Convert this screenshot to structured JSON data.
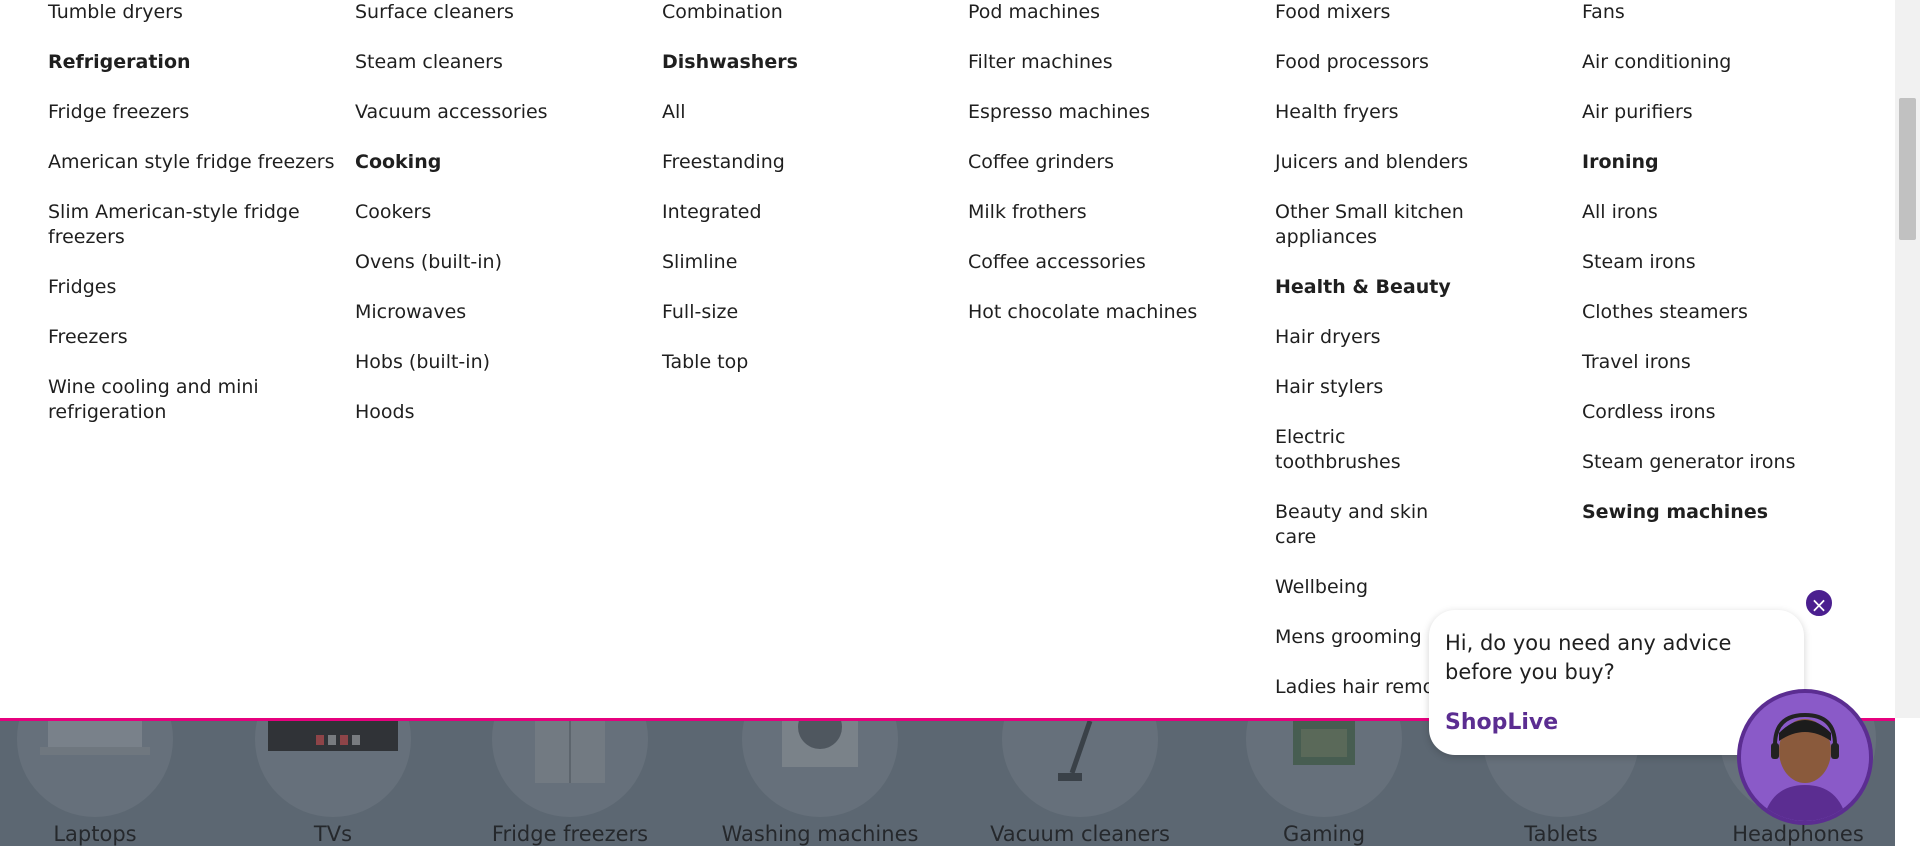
{
  "menu": {
    "col1": {
      "top_item": "Tumble dryers",
      "heading": "Refrigeration",
      "items": [
        "Fridge freezers",
        "American style fridge freezers",
        "Slim American-style fridge freezers",
        "Fridges",
        "Freezers",
        "Wine cooling and mini refrigeration"
      ]
    },
    "col2": {
      "top_items": [
        "Surface cleaners",
        "Steam cleaners",
        "Vacuum accessories"
      ],
      "heading": "Cooking",
      "items": [
        "Cookers",
        "Ovens (built-in)",
        "Microwaves",
        "Hobs (built-in)",
        "Hoods"
      ]
    },
    "col3": {
      "top_item": "Combination",
      "heading": "Dishwashers",
      "items": [
        "All",
        "Freestanding",
        "Integrated",
        "Slimline",
        "Full-size",
        "Table top"
      ]
    },
    "col4": {
      "items": [
        "Pod machines",
        "Filter machines",
        "Espresso machines",
        "Coffee grinders",
        "Milk frothers",
        "Coffee accessories",
        "Hot chocolate machines"
      ]
    },
    "col5": {
      "top_items": [
        "Food mixers",
        "Food processors",
        "Health fryers",
        "Juicers and blenders",
        "Other Small kitchen appliances"
      ],
      "heading": "Health & Beauty",
      "items": [
        "Hair dryers",
        "Hair stylers",
        "Electric toothbrushes",
        "Beauty and skin care",
        "Wellbeing",
        "Mens grooming",
        "Ladies hair removal"
      ]
    },
    "col6": {
      "top_items": [
        "Fans",
        "Air conditioning",
        "Air purifiers"
      ],
      "heading": "Ironing",
      "items": [
        "All irons",
        "Steam irons",
        "Clothes steamers",
        "Travel irons",
        "Cordless irons",
        "Steam generator irons"
      ],
      "heading2": "Sewing machines"
    }
  },
  "categories": [
    "Laptops",
    "TVs",
    "Fridge freezers",
    "Washing machines",
    "Vacuum cleaners",
    "Gaming",
    "Tablets",
    "Headphones"
  ],
  "chat": {
    "message": "Hi, do you need any advice before you buy?",
    "brand": "ShopLive",
    "close_icon": "×"
  },
  "colors": {
    "accent": "#e6007e",
    "brand_purple": "#5b2d91"
  }
}
